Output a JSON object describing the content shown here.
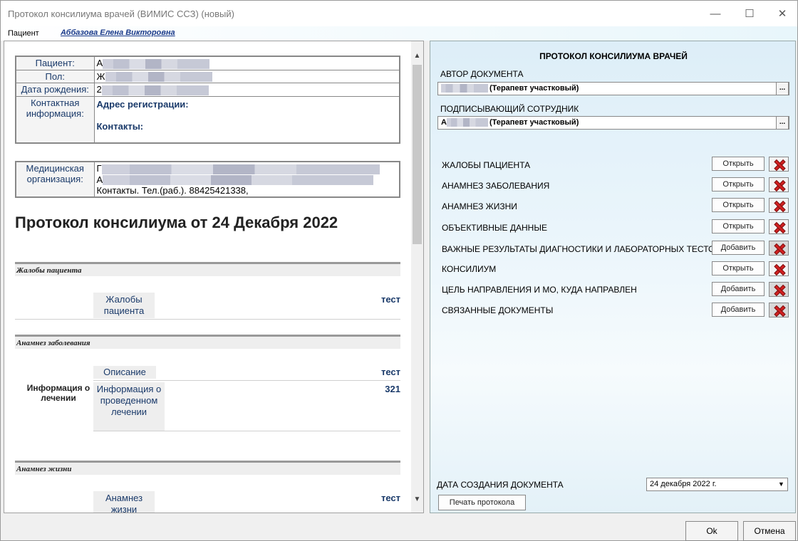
{
  "window": {
    "title": "Протокол консилиума врачей (ВИМИС ССЗ) (новый)",
    "minimize_glyph": "—",
    "maximize_glyph": "☐",
    "close_glyph": "✕"
  },
  "patient_bar": {
    "label": "Пациент",
    "name": "Аббазова Елена Викторовна"
  },
  "document": {
    "info": {
      "patient_label": "Пациент:",
      "patient_value": "А",
      "sex_label": "Пол:",
      "sex_value": "Ж",
      "dob_label": "Дата рождения:",
      "dob_value": "2",
      "contact_label": "Контактная информация:",
      "address_label": "Адрес регистрации:",
      "contacts_label": "Контакты:"
    },
    "org": {
      "label": "Медицинская организация:",
      "line1": "Г",
      "line2": "А",
      "line3": "Контакты. Тел.(раб.). 88425421338,"
    },
    "protocol_title": "Протокол консилиума от 24 Декабря 2022",
    "sections": {
      "complaints": {
        "header": "Жалобы пациента",
        "field_label": "Жалобы пациента",
        "field_value": "тест"
      },
      "disease_history": {
        "header": "Анамнез заболевания",
        "desc_label": "Описание",
        "desc_value": "тест",
        "group_label": "Информация о лечении",
        "treatment_label": "Информация о проведенном лечении",
        "treatment_value": "321"
      },
      "life_history": {
        "header": "Анамнез жизни",
        "field_label": "Анамнез жизни",
        "field_value": "тест"
      }
    },
    "scroll_up": "▲",
    "scroll_down": "▼"
  },
  "right_panel": {
    "title": "ПРОТОКОЛ КОНСИЛИУМА ВРАЧЕЙ",
    "author_label": "АВТОР ДОКУМЕНТА",
    "author_value": "(Терапевт участковый)",
    "signer_label": "ПОДПИСЫВАЮЩИЙ СОТРУДНИК",
    "signer_prefix": "А",
    "signer_value": "(Терапевт участковый)",
    "dots": "...",
    "sections": [
      {
        "label": "ЖАЛОБЫ ПАЦИЕНТА",
        "button": "Открыть"
      },
      {
        "label": "АНАМНЕЗ ЗАБОЛЕВАНИЯ",
        "button": "Открыть"
      },
      {
        "label": "АНАМНЕЗ ЖИЗНИ",
        "button": "Открыть"
      },
      {
        "label": "ОБЪЕКТИВНЫЕ ДАННЫЕ",
        "button": "Открыть"
      },
      {
        "label": "ВАЖНЫЕ РЕЗУЛЬТАТЫ ДИАГНОСТИКИ И ЛАБОРАТОРНЫХ ТЕСТОВ",
        "button": "Добавить"
      },
      {
        "label": "КОНСИЛИУМ",
        "button": "Открыть"
      },
      {
        "label": "ЦЕЛЬ НАПРАВЛЕНИЯ И МО, КУДА НАПРАВЛЕН",
        "button": "Добавить"
      },
      {
        "label": "СВЯЗАННЫЕ ДОКУМЕНТЫ",
        "button": "Добавить"
      }
    ],
    "date_label": "ДАТА СОЗДАНИЯ ДОКУМЕНТА",
    "date_value": "24 декабря  2022 г.",
    "date_arrow": "▼",
    "print_button": "Печать протокола"
  },
  "footer": {
    "ok": "Ok",
    "cancel": "Отмена"
  }
}
